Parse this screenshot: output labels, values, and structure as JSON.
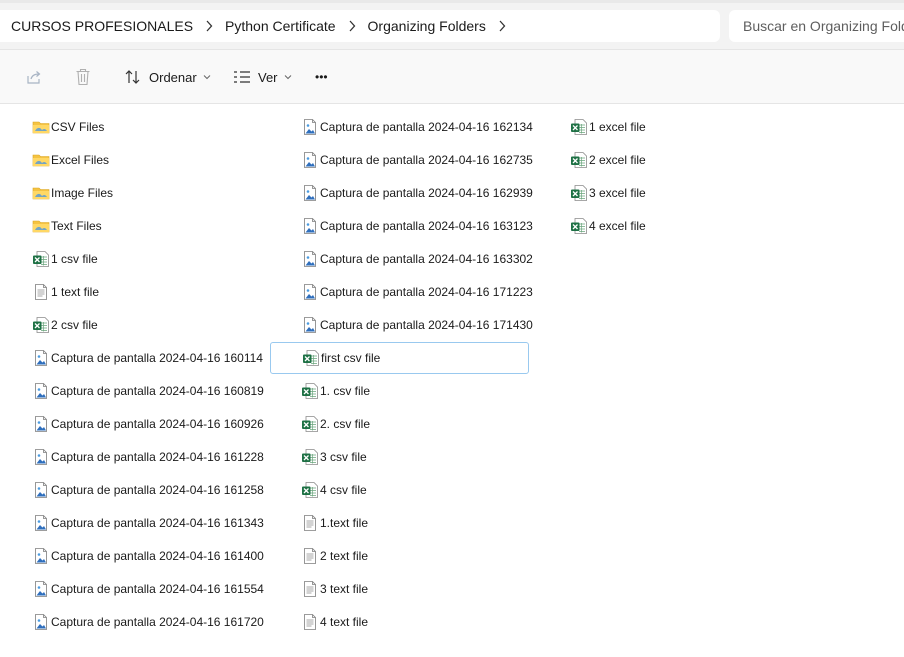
{
  "address_bar": {
    "crumbs": [
      "CURSOS PROFESIONALES",
      "Python Certificate",
      "Organizing Folders"
    ],
    "search_placeholder": "Buscar en Organizing Folders"
  },
  "command_bar": {
    "sort_label": "Ordenar",
    "view_label": "Ver",
    "more_label": "•••"
  },
  "files": {
    "col1": [
      {
        "name": "CSV Files",
        "type": "folder"
      },
      {
        "name": "Excel Files",
        "type": "folder"
      },
      {
        "name": "Image Files",
        "type": "folder"
      },
      {
        "name": "Text Files",
        "type": "folder"
      },
      {
        "name": "1 csv file",
        "type": "csv"
      },
      {
        "name": "1 text file",
        "type": "text"
      },
      {
        "name": "2 csv file",
        "type": "csv"
      },
      {
        "name": "Captura de pantalla 2024-04-16 160114",
        "type": "image"
      },
      {
        "name": "Captura de pantalla 2024-04-16 160819",
        "type": "image"
      },
      {
        "name": "Captura de pantalla 2024-04-16 160926",
        "type": "image"
      },
      {
        "name": "Captura de pantalla 2024-04-16 161228",
        "type": "image"
      },
      {
        "name": "Captura de pantalla 2024-04-16 161258",
        "type": "image"
      },
      {
        "name": "Captura de pantalla 2024-04-16 161343",
        "type": "image"
      },
      {
        "name": "Captura de pantalla 2024-04-16 161400",
        "type": "image"
      },
      {
        "name": "Captura de pantalla 2024-04-16 161554",
        "type": "image"
      },
      {
        "name": "Captura de pantalla 2024-04-16 161720",
        "type": "image"
      }
    ],
    "col2": [
      {
        "name": "Captura de pantalla 2024-04-16 162134",
        "type": "image"
      },
      {
        "name": "Captura de pantalla 2024-04-16 162735",
        "type": "image"
      },
      {
        "name": "Captura de pantalla 2024-04-16 162939",
        "type": "image"
      },
      {
        "name": "Captura de pantalla 2024-04-16 163123",
        "type": "image"
      },
      {
        "name": "Captura de pantalla 2024-04-16 163302",
        "type": "image"
      },
      {
        "name": "Captura de pantalla 2024-04-16 171223",
        "type": "image"
      },
      {
        "name": "Captura de pantalla 2024-04-16 171430",
        "type": "image"
      },
      {
        "name": "first csv file",
        "type": "csv",
        "selected": true
      },
      {
        "name": "1. csv file",
        "type": "csv"
      },
      {
        "name": "2. csv file",
        "type": "csv"
      },
      {
        "name": "3 csv file",
        "type": "csv"
      },
      {
        "name": "4 csv file",
        "type": "csv"
      },
      {
        "name": "1.text file",
        "type": "text"
      },
      {
        "name": "2 text file",
        "type": "text"
      },
      {
        "name": "3 text file",
        "type": "text"
      },
      {
        "name": "4 text file",
        "type": "text"
      }
    ],
    "col3": [
      {
        "name": "1 excel file",
        "type": "excel"
      },
      {
        "name": "2 excel file",
        "type": "excel"
      },
      {
        "name": "3 excel file",
        "type": "excel"
      },
      {
        "name": "4 excel file",
        "type": "excel"
      }
    ]
  },
  "colors": {
    "folder": "#f5c342",
    "excel_green": "#1e7145",
    "image_blue": "#2f6fbd",
    "selection_border": "#99c9ef"
  }
}
